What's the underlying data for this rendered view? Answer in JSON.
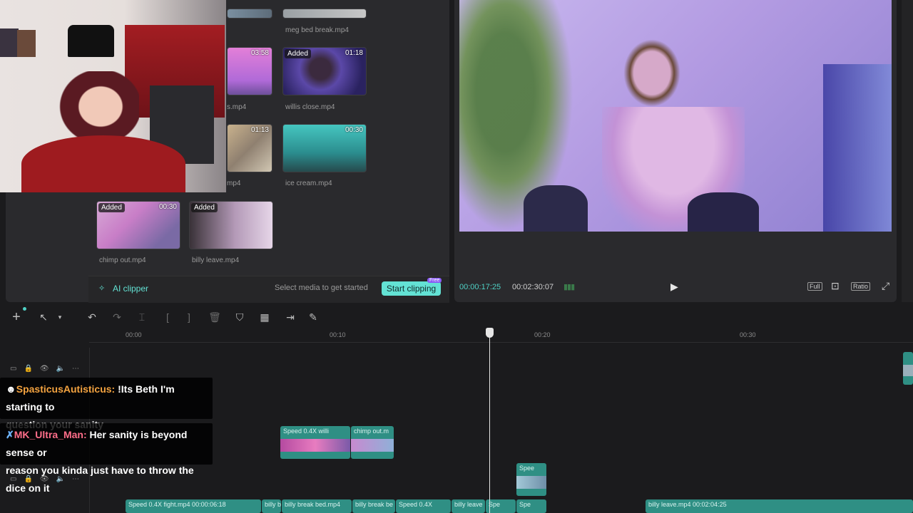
{
  "media": {
    "items": [
      {
        "name": "meg bed break.mp4",
        "badge": "",
        "duration": ""
      },
      {
        "name": "s.mp4",
        "badge": "",
        "duration": "03:58"
      },
      {
        "name": "willis close.mp4",
        "badge": "Added",
        "duration": "01:18"
      },
      {
        "name": "mp4",
        "badge": "",
        "duration": "01:13"
      },
      {
        "name": "ice cream.mp4",
        "badge": "",
        "duration": "00:30"
      },
      {
        "name": "chimp out.mp4",
        "badge": "Added",
        "duration": "00:30"
      },
      {
        "name": "billy leave.mp4",
        "badge": "Added",
        "duration": ""
      }
    ],
    "ai_clipper": "AI clipper",
    "select_hint": "Select media to get started",
    "start_clipping": "Start clipping",
    "free_tag": "Free"
  },
  "player": {
    "current_time": "00:00:17:25",
    "total_time": "00:02:30:07",
    "full_label": "Full",
    "ratio_label": "Ratio"
  },
  "timeline": {
    "ticks": [
      "00:00",
      "00:10",
      "00:20",
      "00:30"
    ],
    "clips": {
      "c1": "Speed 0.4X  willi",
      "c2": "chimp out.m",
      "c3": "Spee",
      "b1": "Speed 0.4X  fight.mp4  00:00:06:18",
      "b2": "billy b",
      "b3": "billy break bed.mp4",
      "b4": "billy break be",
      "b5": "Speed 0.4X",
      "b6": "billy leave",
      "b7": "Spe",
      "b8": "Spe",
      "b9": "billy leave.mp4  00:02:04:25"
    }
  },
  "chat": [
    {
      "name": "SpasticusAutisticus:",
      "text": " !Its Beth I'm starting to",
      "text2": "question your sanity"
    },
    {
      "name": "MK_Ultra_Man:",
      "text": " Her sanity is beyond sense or",
      "text2": "reason you kinda just have to throw the dice on it"
    }
  ],
  "colors": {
    "accent": "#63e2d4",
    "clip": "#2f8f84",
    "timecode": "#4fd1c5"
  }
}
